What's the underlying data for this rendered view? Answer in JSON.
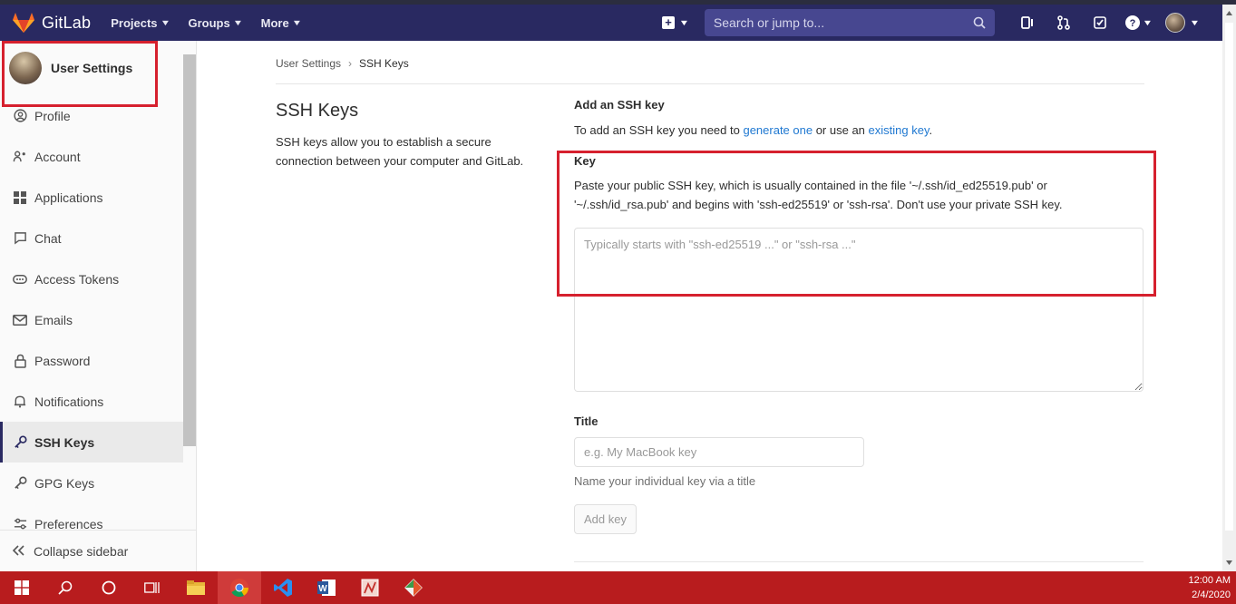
{
  "navbar": {
    "brand": "GitLab",
    "items": [
      {
        "label": "Projects"
      },
      {
        "label": "Groups"
      },
      {
        "label": "More"
      }
    ],
    "search_placeholder": "Search or jump to...",
    "accent": "#292961"
  },
  "sidebar": {
    "title": "User Settings",
    "items": [
      {
        "label": "Profile",
        "icon": "profile-icon"
      },
      {
        "label": "Account",
        "icon": "account-icon"
      },
      {
        "label": "Applications",
        "icon": "applications-icon"
      },
      {
        "label": "Chat",
        "icon": "chat-icon"
      },
      {
        "label": "Access Tokens",
        "icon": "token-icon"
      },
      {
        "label": "Emails",
        "icon": "email-icon"
      },
      {
        "label": "Password",
        "icon": "lock-icon"
      },
      {
        "label": "Notifications",
        "icon": "bell-icon"
      },
      {
        "label": "SSH Keys",
        "icon": "key-icon",
        "active": true
      },
      {
        "label": "GPG Keys",
        "icon": "key-icon"
      },
      {
        "label": "Preferences",
        "icon": "preferences-icon"
      }
    ],
    "collapse_label": "Collapse sidebar"
  },
  "breadcrumb": {
    "parent": "User Settings",
    "current": "SSH Keys"
  },
  "page": {
    "title": "SSH Keys",
    "description": "SSH keys allow you to establish a secure connection between your computer and GitLab."
  },
  "form": {
    "heading": "Add an SSH key",
    "intro_pre": "To add an SSH key you need to ",
    "intro_link1": "generate one",
    "intro_mid": " or use an ",
    "intro_link2": "existing key",
    "intro_post": ".",
    "key_label": "Key",
    "key_help": "Paste your public SSH key, which is usually contained in the file '~/.ssh/id_ed25519.pub' or '~/.ssh/id_rsa.pub' and begins with 'ssh-ed25519' or 'ssh-rsa'. Don't use your private SSH key.",
    "key_placeholder": "Typically starts with \"ssh-ed25519 ...\" or \"ssh-rsa ...\"",
    "title_label": "Title",
    "title_placeholder": "e.g. My MacBook key",
    "title_help": "Name your individual key via a title",
    "submit_label": "Add key"
  },
  "taskbar": {
    "time": "12:00 AM",
    "date": "2/4/2020"
  },
  "colors": {
    "highlight": "#d6202e",
    "link": "#1f78d1",
    "taskbar": "#b81c1e"
  }
}
